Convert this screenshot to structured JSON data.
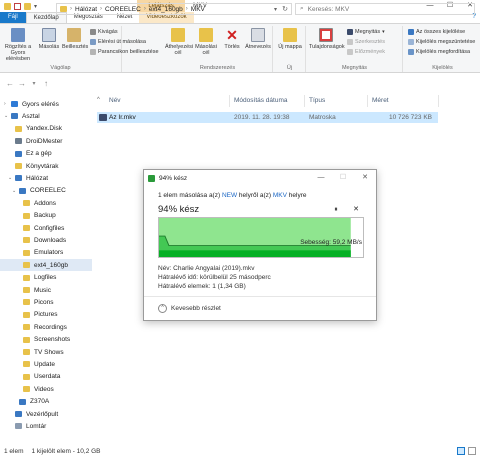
{
  "window": {
    "title": "MKV",
    "context_tab_header": "Lejátszás",
    "controls": [
      "—",
      "☐",
      "✕"
    ]
  },
  "ribbon": {
    "tabs": [
      "Fájl",
      "Kezdőlap",
      "Megosztás",
      "Nézet",
      "Videoeszközök"
    ],
    "help": "?",
    "groups": {
      "clipboard": {
        "label": "Vágólap",
        "pin": "Rögzítés a Gyors elérésben",
        "copy": "Másolás",
        "paste": "Beillesztés",
        "cut": "Kivágás",
        "copy_path": "Elérési út másolása",
        "paste_shortcut": "Parancsikon beillesztése"
      },
      "organize": {
        "label": "Rendszerezés",
        "move_to": "Áthelyezési cél",
        "copy_to": "Másolási cél",
        "delete": "Törlés",
        "rename": "Átnevezés"
      },
      "new": {
        "label": "Új",
        "new_folder": "Új mappa"
      },
      "open": {
        "label": "Megnyitás",
        "properties": "Tulajdonságok",
        "open": "Megnyitás",
        "edit": "Szerkesztés",
        "history": "Előzmények"
      },
      "select": {
        "label": "Kijelölés",
        "select_all": "Az összes kijelölése",
        "select_none": "Kijelölés megszüntetése",
        "invert": "Kijelölés megfordítása"
      }
    }
  },
  "address": {
    "path": [
      "Hálózat",
      "COREELEC",
      "ext4_160gb",
      "MKV"
    ],
    "search_placeholder": "Keresés: MKV"
  },
  "nav": {
    "items": [
      {
        "label": "Gyors elérés",
        "icon": "star-icon",
        "color": "#2e7bd6",
        "indent": 0
      },
      {
        "label": "Asztal",
        "icon": "desktop-icon",
        "color": "#3a78c2",
        "indent": 0
      },
      {
        "label": "Yandex.Disk",
        "icon": "cloud-icon",
        "color": "#e8c24a",
        "indent": 1
      },
      {
        "label": "DroiDMester",
        "icon": "user-icon",
        "color": "#6b7b8c",
        "indent": 1
      },
      {
        "label": "Ez a gép",
        "icon": "computer-icon",
        "color": "#3a78c2",
        "indent": 1
      },
      {
        "label": "Könyvtárak",
        "icon": "library-icon",
        "color": "#e8c24a",
        "indent": 1
      },
      {
        "label": "Hálózat",
        "icon": "network-icon",
        "color": "#3a78c2",
        "indent": 1
      },
      {
        "label": "COREELEC",
        "icon": "computer-icon",
        "color": "#3a78c2",
        "indent": 2
      },
      {
        "label": "Addons",
        "icon": "folder-icon",
        "color": "#e8c24a",
        "indent": 3
      },
      {
        "label": "Backup",
        "icon": "folder-icon",
        "color": "#e8c24a",
        "indent": 3
      },
      {
        "label": "Configfiles",
        "icon": "folder-icon",
        "color": "#e8c24a",
        "indent": 3
      },
      {
        "label": "Downloads",
        "icon": "folder-icon",
        "color": "#e8c24a",
        "indent": 3
      },
      {
        "label": "Emulators",
        "icon": "folder-icon",
        "color": "#e8c24a",
        "indent": 3
      },
      {
        "label": "ext4_160gb",
        "icon": "folder-icon",
        "color": "#e8c24a",
        "indent": 3
      },
      {
        "label": "Logfiles",
        "icon": "folder-icon",
        "color": "#e8c24a",
        "indent": 3
      },
      {
        "label": "Music",
        "icon": "folder-icon",
        "color": "#e8c24a",
        "indent": 3
      },
      {
        "label": "Picons",
        "icon": "folder-icon",
        "color": "#e8c24a",
        "indent": 3
      },
      {
        "label": "Pictures",
        "icon": "folder-icon",
        "color": "#e8c24a",
        "indent": 3
      },
      {
        "label": "Recordings",
        "icon": "folder-icon",
        "color": "#e8c24a",
        "indent": 3
      },
      {
        "label": "Screenshots",
        "icon": "folder-icon",
        "color": "#e8c24a",
        "indent": 3
      },
      {
        "label": "TV Shows",
        "icon": "folder-icon",
        "color": "#e8c24a",
        "indent": 3
      },
      {
        "label": "Update",
        "icon": "folder-icon",
        "color": "#e8c24a",
        "indent": 3
      },
      {
        "label": "Userdata",
        "icon": "folder-icon",
        "color": "#e8c24a",
        "indent": 3
      },
      {
        "label": "Videos",
        "icon": "folder-icon",
        "color": "#e8c24a",
        "indent": 3
      },
      {
        "label": "Z370A",
        "icon": "computer-icon",
        "color": "#3a78c2",
        "indent": 2
      },
      {
        "label": "Vezérlőpult",
        "icon": "control-panel-icon",
        "color": "#3a78c2",
        "indent": 1
      },
      {
        "label": "Lomtár",
        "icon": "recycle-bin-icon",
        "color": "#8a9bb0",
        "indent": 1
      }
    ],
    "selected_index": 13
  },
  "files": {
    "columns": [
      "Név",
      "Módosítás dátuma",
      "Típus",
      "Méret"
    ],
    "rows": [
      {
        "name": "Az Ir.mkv",
        "date": "2019. 11. 28. 19:38",
        "type": "Matroska",
        "size": "10 726 723 KB"
      }
    ]
  },
  "status": {
    "count": "1 elem",
    "selection": "1 kijelölt elem - 10,2 GB"
  },
  "dialog": {
    "title": "94% kész",
    "line_prefix": "1 elem másolása a(z) ",
    "line_src": "NEW",
    "line_mid": " helyről a(z) ",
    "line_dst": "MKV",
    "line_suffix": " helyre",
    "percent_label": "94% kész",
    "progress_fraction": 0.94,
    "pause_icon": "⏸",
    "close_icon": "✕",
    "speed": "Sebesség: 59,2 MB/s",
    "name": "Név: Charlie Angyalai (2019).mkv",
    "time_left": "Hátralévő idő: körülbelül 25 másodperc",
    "items_left": "Hátralévő elemek: 1 (1,34 GB)",
    "less_details": "Kevesebb részlet",
    "colors": {
      "fill": "#8fe58f",
      "fill_dark": "#06b025",
      "line": "#1e7d2c"
    }
  }
}
